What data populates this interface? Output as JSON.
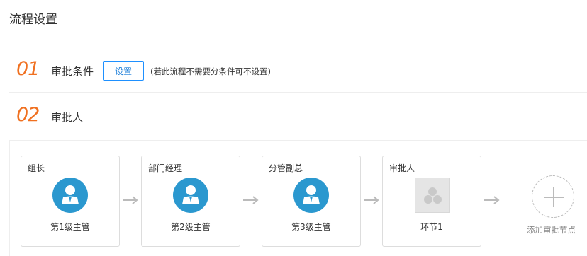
{
  "page": {
    "title": "流程设置"
  },
  "section1": {
    "number": "01",
    "label": "审批条件",
    "button_label": "设置",
    "hint": "(若此流程不需要分条件可不设置)"
  },
  "section2": {
    "number": "02",
    "label": "审批人"
  },
  "flow": {
    "nodes": [
      {
        "title": "组长",
        "subtitle": "第1级主管",
        "icon": "person-icon"
      },
      {
        "title": "部门经理",
        "subtitle": "第2级主管",
        "icon": "person-icon"
      },
      {
        "title": "分管副总",
        "subtitle": "第3级主管",
        "icon": "person-icon"
      },
      {
        "title": "审批人",
        "subtitle": "环节1",
        "icon": "group-icon"
      }
    ],
    "add_label": "添加审批节点"
  },
  "colors": {
    "accent_orange": "#f07020",
    "avatar_blue": "#2b98cf",
    "button_blue": "#1e7fd9"
  }
}
